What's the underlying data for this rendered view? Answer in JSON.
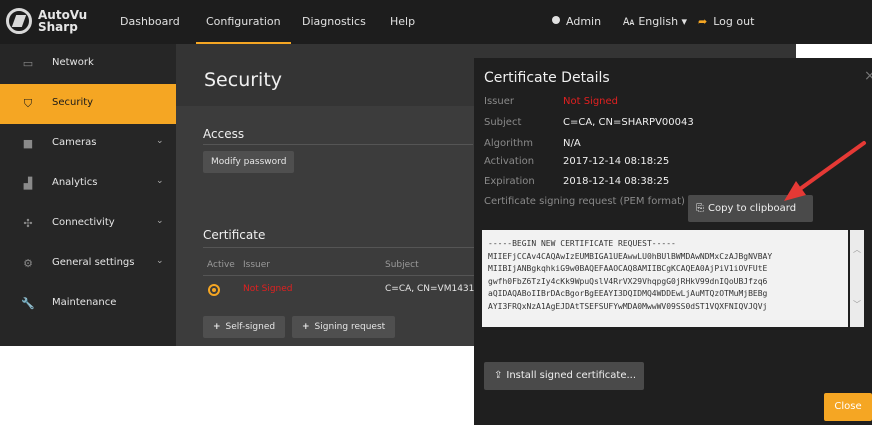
{
  "app": {
    "logo_line1": "AutoVu",
    "logo_line2": "Sharp",
    "logo_icon": "autovu-logo-icon"
  },
  "topnav": {
    "items": [
      {
        "label": "Dashboard",
        "active": false
      },
      {
        "label": "Configuration",
        "active": true
      },
      {
        "label": "Diagnostics",
        "active": false
      },
      {
        "label": "Help",
        "active": false
      }
    ],
    "user": "Admin",
    "language": "English ▾",
    "logout": "Log out",
    "accent_color": "#f5a623"
  },
  "sidebar": {
    "items": [
      {
        "label": "Network",
        "icon": "network-icon",
        "active": false,
        "chevron": ""
      },
      {
        "label": "Security",
        "icon": "shield-icon",
        "active": true,
        "chevron": ""
      },
      {
        "label": "Cameras",
        "icon": "camera-icon",
        "active": false,
        "chevron": "⌄"
      },
      {
        "label": "Analytics",
        "icon": "bar-chart-icon",
        "active": false,
        "chevron": "⌄"
      },
      {
        "label": "Connectivity",
        "icon": "puzzle-icon",
        "active": false,
        "chevron": "⌄"
      },
      {
        "label": "General settings",
        "icon": "gear-icon",
        "active": false,
        "chevron": "⌄"
      },
      {
        "label": "Maintenance",
        "icon": "wrench-icon",
        "active": false,
        "chevron": ""
      }
    ]
  },
  "main": {
    "title": "Security",
    "access": {
      "heading": "Access",
      "modify_password": "Modify password"
    },
    "certificate": {
      "heading": "Certificate",
      "columns": [
        "Active",
        "Issuer",
        "Subject"
      ],
      "row": {
        "issuer": "Not Signed",
        "subject": "C=CA, CN=VM1431"
      },
      "self_signed": "Self-signed",
      "signing_request": "Signing request"
    }
  },
  "modal": {
    "title": "Certificate Details",
    "close_x": "×",
    "fields": [
      {
        "key": "Issuer",
        "value": "Not Signed",
        "value_color": "#e02020"
      },
      {
        "key": "Subject",
        "value": "C=CA, CN=SHARPV00043",
        "value_color": "#f0f0f0"
      },
      {
        "key": "Algorithm",
        "value": "N/A",
        "value_color": "#f0f0f0"
      },
      {
        "key": "Activation",
        "value": "2017-12-14 08:18:25",
        "value_color": "#f0f0f0"
      },
      {
        "key": "Expiration",
        "value": "2018-12-14 08:38:25",
        "value_color": "#f0f0f0"
      }
    ],
    "pem_label": "Certificate signing request (PEM format)",
    "copy_button": "Copy to clipboard",
    "pem_lines": [
      "-----BEGIN NEW CERTIFICATE REQUEST-----",
      "MIIEFjCCAv4CAQAwIzEUMBIGA1UEAwwLU0hBUlBWMDAwNDMxCzAJBgNVBAY",
      "MIIBIjANBgkqhkiG9w0BAQEFAAOCAQ8AMIIBCgKCAQEA0AjPiV1iOVFUtE",
      "gwfh0FbZ6TzIy4cKk9WpuQslV4RrVX29VhqpgG0jRHkV99dnIQoUBJfzq6",
      "aQIDAQABoIIBrDAcBgorBgEEAYI3DQIDMQ4WDDEwLjAuMTQzOTMuMjBEBg",
      "AYI3FRQxNzA1AgEJDAtTSEFSUFYwMDA0MwwWV09SS0dST1VQXFNIQVJQVj"
    ],
    "install_button": "Install signed certificate...",
    "close_button": "Close"
  }
}
